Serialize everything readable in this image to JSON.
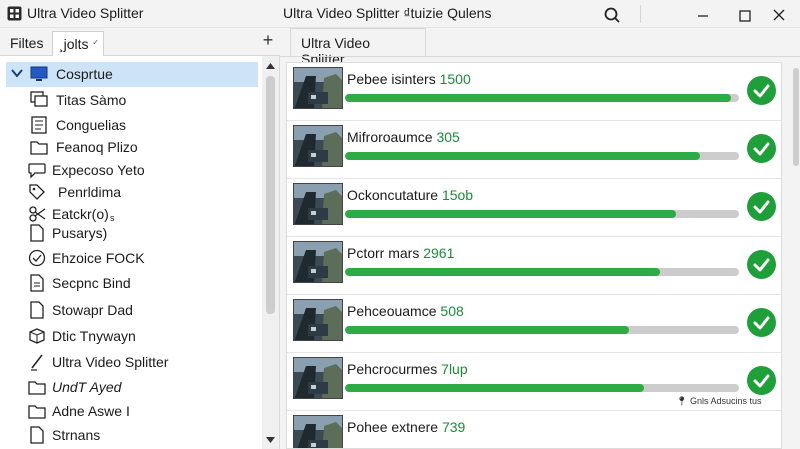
{
  "titlebar": {
    "app_name": "Ultra Video Splitter",
    "window_title": "Ultra Video Splitter ₫tuizie Qulens"
  },
  "left_panel": {
    "tabs": [
      {
        "label": "Filtes"
      },
      {
        "label": "¸jolts"
      }
    ],
    "add_tab": "+",
    "tree": [
      {
        "label": "Cosprtue",
        "icon": "monitor-icon",
        "selected": true,
        "expanded": true
      },
      {
        "label": "Titas Sàmo",
        "icon": "screen-copy-icon"
      },
      {
        "label": "Conguelias",
        "icon": "document-list-icon"
      },
      {
        "label": "Feanoq Plizo",
        "icon": "folder-doc-icon"
      },
      {
        "label": "Expecoso Yeto",
        "icon": "chat-bubble-icon"
      },
      {
        "label": "Penrldima",
        "icon": "tag-icon"
      },
      {
        "label": "Eatckr(o)",
        "icon": "scissors-icon",
        "extra": "s"
      },
      {
        "label": "Pusarys)",
        "icon": "document-icon"
      },
      {
        "label": "Ehzoice FOCK",
        "icon": "check-circle-icon"
      },
      {
        "label": "Secpnc Bind",
        "icon": "document-lines-icon"
      },
      {
        "label": "Stowapr Dad",
        "icon": "document-icon"
      },
      {
        "label": "Dtic Tnywayn",
        "icon": "box-icon"
      },
      {
        "label": "Ultra Video Splitter",
        "icon": "pen-icon"
      },
      {
        "label": "UndT Ayed",
        "icon": "folder-icon"
      },
      {
        "label": "Adne Aswe I",
        "icon": "folder-icon"
      },
      {
        "label": "Strnans",
        "icon": "document-icon"
      }
    ]
  },
  "right_panel": {
    "tab": "Ultra Video Splitter",
    "status_note": "Gnls Adsucins tus",
    "items": [
      {
        "name": "Pebee isinters",
        "value": "1500",
        "progress": 0.98,
        "status": "check-icon"
      },
      {
        "name": "Mifroroaumce",
        "value": "305",
        "progress": 0.9,
        "status": "check-icon"
      },
      {
        "name": "Ockoncutature",
        "value": "15ob",
        "progress": 0.84,
        "status": "check-icon"
      },
      {
        "name": "Pctorr mars",
        "value": "2961",
        "progress": 0.8,
        "status": "check-icon"
      },
      {
        "name": "Pehceouamce",
        "value": "508",
        "progress": 0.72,
        "status": "check-icon"
      },
      {
        "name": "Pehcrocurmes",
        "value": "7lup",
        "progress": 0.76,
        "status": "check-icon"
      },
      {
        "name": "Pohee extnere",
        "value": "739",
        "progress": 0.0,
        "status": ""
      }
    ]
  },
  "colors": {
    "accent_green": "#2dab46",
    "check_green": "#1f9f3a",
    "selection": "#cde3f7",
    "value_text": "#1e8a3a"
  }
}
